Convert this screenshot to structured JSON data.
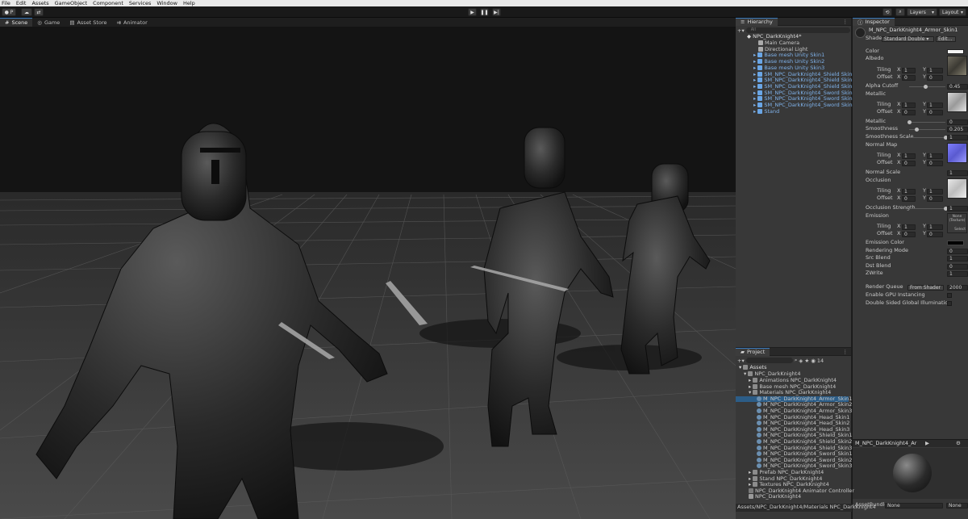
{
  "menu": [
    "File",
    "Edit",
    "Assets",
    "GameObject",
    "Component",
    "Services",
    "Window",
    "Help"
  ],
  "toolbar": {
    "account": "P",
    "layers": "Layers",
    "layout": "Layout"
  },
  "scene_tabs": [
    "Scene",
    "Game",
    "Asset Store",
    "Animator"
  ],
  "hierarchy": {
    "tab": "Hierarchy",
    "search_placeholder": "All",
    "root": "NPC_DarkKnight4*",
    "items": [
      {
        "label": "Main Camera",
        "prefab": false
      },
      {
        "label": "Directional Light",
        "prefab": false
      },
      {
        "label": "Base mesh Unity Skin1",
        "prefab": true
      },
      {
        "label": "Base mesh Unity Skin2",
        "prefab": true
      },
      {
        "label": "Base mesh Unity Skin3",
        "prefab": true
      },
      {
        "label": "SM_NPC_DarkKnight4_Shield Skin1",
        "prefab": true
      },
      {
        "label": "SM_NPC_DarkKnight4_Shield Skin2",
        "prefab": true
      },
      {
        "label": "SM_NPC_DarkKnight4_Shield Skin3",
        "prefab": true
      },
      {
        "label": "SM_NPC_DarkKnight4_Sword Skin1",
        "prefab": true
      },
      {
        "label": "SM_NPC_DarkKnight4_Sword Skin2",
        "prefab": true
      },
      {
        "label": "SM_NPC_DarkKnight4_Sword Skin3",
        "prefab": true
      },
      {
        "label": "Stand",
        "prefab": true
      }
    ]
  },
  "inspector": {
    "tab": "Inspector",
    "material_name": "M_NPC_DarkKnight4_Armor_Skin1",
    "shader_label": "Shader",
    "shader_value": "Standard Double",
    "edit_label": "Edit...",
    "props": {
      "color": "Color",
      "albedo": "Albedo",
      "tiling": "Tiling",
      "offset": "Offset",
      "x": "X",
      "y": "Y",
      "one": "1",
      "zero": "0",
      "alpha_cutoff": "Alpha Cutoff",
      "alpha_cutoff_value": "0.45",
      "metallic_map": "Metallic",
      "metallic": "Metallic",
      "metallic_value": "0",
      "smoothness": "Smoothness",
      "smoothness_value": "0.205",
      "smoothness_scale": "Smoothness Scale",
      "smoothness_scale_value": "1",
      "normal_map": "Normal Map",
      "normal_scale": "Normal Scale",
      "normal_scale_value": "1",
      "occlusion": "Occlusion",
      "occlusion_strength": "Occlusion Strength",
      "occlusion_strength_value": "1",
      "emission": "Emission",
      "emission_none": "None",
      "emission_texture": "(Texture)",
      "select": "Select",
      "emission_color": "Emission Color",
      "rendering_mode": "Rendering Mode",
      "rendering_mode_value": "0",
      "src_blend": "Src Blend",
      "src_blend_value": "1",
      "dst_blend": "Dst Blend",
      "dst_blend_value": "0",
      "zwrite": "ZWrite",
      "zwrite_value": "1",
      "render_queue": "Render Queue",
      "render_queue_mode": "From Shader",
      "render_queue_value": "2000",
      "gpu_instancing": "Enable GPU Instancing",
      "double_sided_gi": "Double Sided Global Illumination"
    },
    "preview_title": "M_NPC_DarkKnight4_Ar",
    "asset_bundle": "AssetBundle",
    "asset_bundle_value": "None",
    "asset_bundle_variant": "None"
  },
  "project": {
    "tab": "Project",
    "count": "14",
    "root": "Assets",
    "folder": "NPC_DarkKnight4",
    "items": [
      {
        "label": "Animations NPC_DarkKnight4",
        "level": 2,
        "kind": "folder"
      },
      {
        "label": "Base mesh NPC_DarkKnight4",
        "level": 2,
        "kind": "folder"
      },
      {
        "label": "Materials NPC_DarkKnight4",
        "level": 2,
        "kind": "folder-open"
      },
      {
        "label": "M_NPC_DarkKnight4_Armor_Skin1",
        "level": 3,
        "kind": "mat",
        "selected": true
      },
      {
        "label": "M_NPC_DarkKnight4_Armor_Skin2",
        "level": 3,
        "kind": "mat"
      },
      {
        "label": "M_NPC_DarkKnight4_Armor_Skin3",
        "level": 3,
        "kind": "mat"
      },
      {
        "label": "M_NPC_DarkKnight4_Head_Skin1",
        "level": 3,
        "kind": "mat"
      },
      {
        "label": "M_NPC_DarkKnight4_Head_Skin2",
        "level": 3,
        "kind": "mat"
      },
      {
        "label": "M_NPC_DarkKnight4_Head_Skin3",
        "level": 3,
        "kind": "mat"
      },
      {
        "label": "M_NPC_DarkKnight4_Shield_Skin1",
        "level": 3,
        "kind": "mat"
      },
      {
        "label": "M_NPC_DarkKnight4_Shield_Skin2",
        "level": 3,
        "kind": "mat"
      },
      {
        "label": "M_NPC_DarkKnight4_Shield_Skin3",
        "level": 3,
        "kind": "mat"
      },
      {
        "label": "M_NPC_DarkKnight4_Sword_Skin1",
        "level": 3,
        "kind": "mat"
      },
      {
        "label": "M_NPC_DarkKnight4_Sword_Skin2",
        "level": 3,
        "kind": "mat"
      },
      {
        "label": "M_NPC_DarkKnight4_Sword_Skin3",
        "level": 3,
        "kind": "mat"
      },
      {
        "label": "Prefab NPC_DarkKnight4",
        "level": 2,
        "kind": "folder"
      },
      {
        "label": "Stand NPC_DarkKnight4",
        "level": 2,
        "kind": "folder"
      },
      {
        "label": "Textures NPC_DarkKnight4",
        "level": 2,
        "kind": "folder"
      },
      {
        "label": "NPC_DarkKnight4 Animator Controller",
        "level": 2,
        "kind": "anim"
      },
      {
        "label": "NPC_DarkKnight4",
        "level": 2,
        "kind": "scene"
      }
    ],
    "path": "Assets/NPC_DarkKnight4/Materials NPC_DarkKnight4"
  }
}
